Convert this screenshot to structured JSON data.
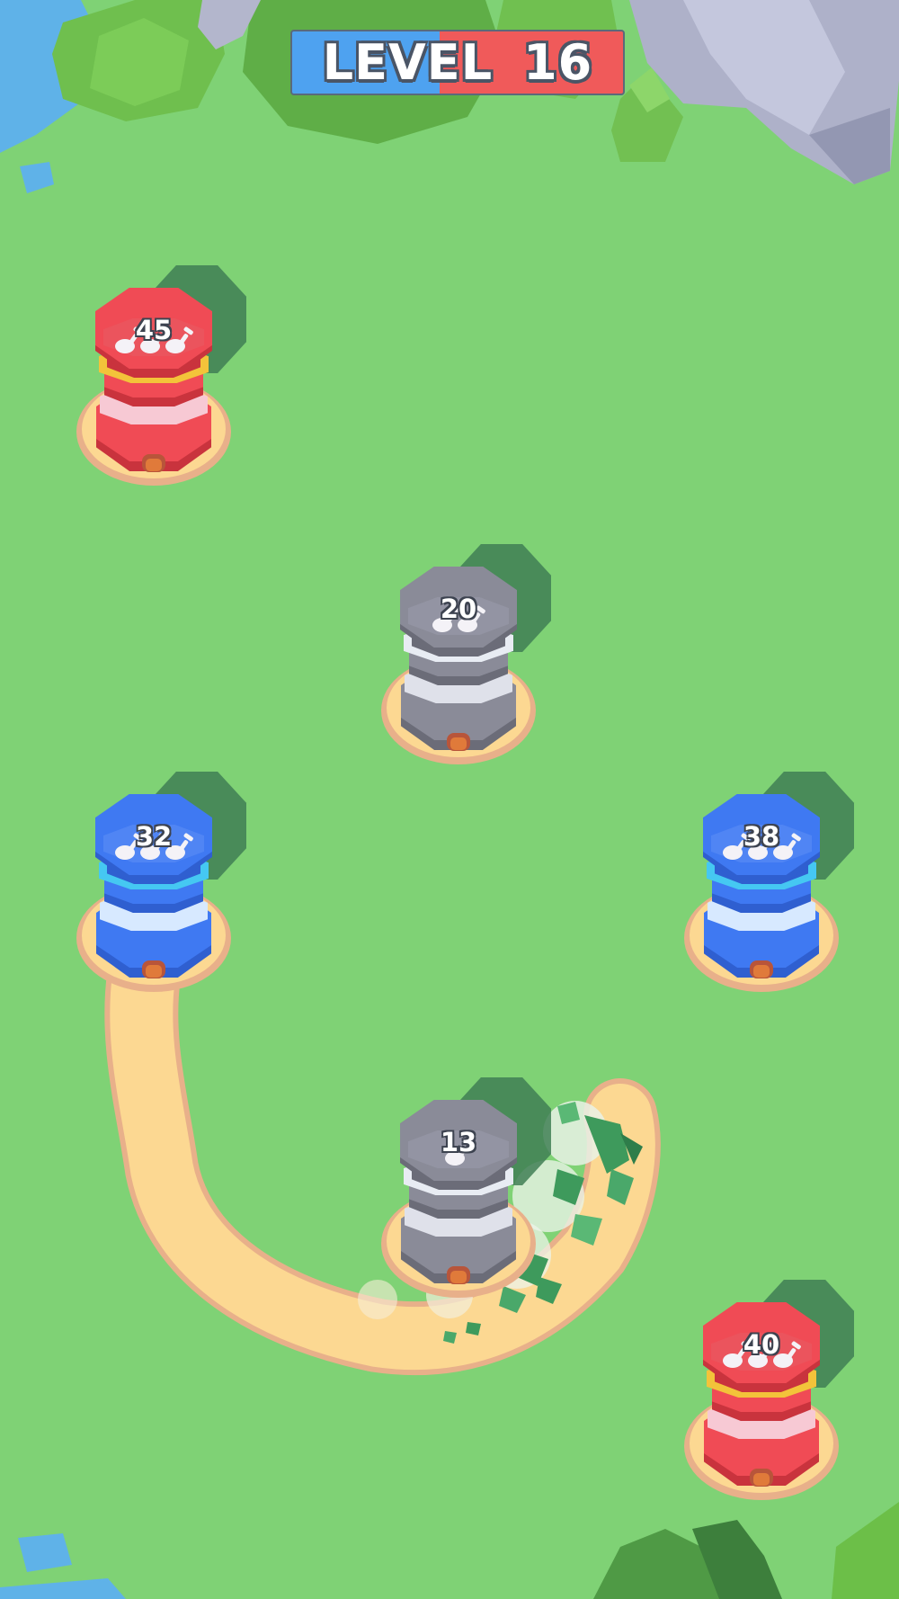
{
  "level": {
    "word": "LEVEL",
    "number": "16"
  },
  "colors": {
    "grass": "#7fd275",
    "path": "#fcd892",
    "red_team": "#f04b55",
    "blue_team": "#3f79f2",
    "neutral": "#8a8b98",
    "banner_blue": "#4ea2f0",
    "banner_red": "#f05a5a"
  },
  "towers": [
    {
      "team": "red",
      "count": "45",
      "icon": "shovel-icons"
    },
    {
      "team": "neutral",
      "count": "20",
      "icon": "shovel-icons"
    },
    {
      "team": "blue",
      "count": "32",
      "icon": "shovel-icons"
    },
    {
      "team": "blue",
      "count": "38",
      "icon": "shovel-icons"
    },
    {
      "team": "neutral",
      "count": "13",
      "icon": "shovel-icon"
    },
    {
      "team": "red",
      "count": "40",
      "icon": "shovel-icons"
    }
  ]
}
